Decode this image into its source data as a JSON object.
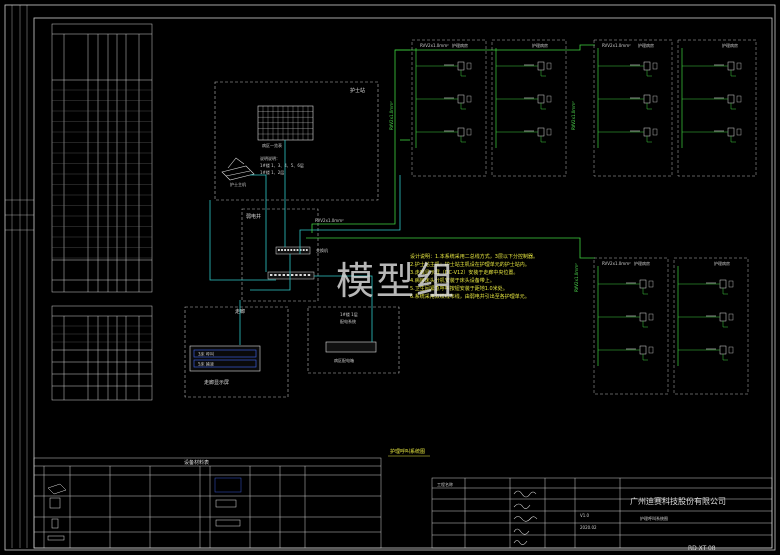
{
  "colors": {
    "background": "#000000",
    "frame": "#cfcfcf",
    "wire_green": "#3fd23f",
    "wire_cyan": "#2fc7c7",
    "label_yellow": "#e8e840",
    "screen_blue": "#3a5bd8"
  },
  "watermark": "模型组",
  "wards": {
    "label": "护理病房",
    "cable_spec": "RVV2x1.0mm²"
  },
  "nurse_station": {
    "label": "护士站",
    "console_label": "护士主机",
    "box_label": "病区一览表"
  },
  "equipment_room": {
    "label": "弱电井",
    "switch_label": "交换机"
  },
  "corridor": {
    "label": "走廊",
    "display_label": "走廊显示屏",
    "display_text_1": "3床 呼叫",
    "display_text_2": "5床 输液"
  },
  "power_box": {
    "label": "病区配电箱"
  },
  "system_title": "护理呼叫系统图",
  "equipment_list_title": "设备材料表",
  "title_block": {
    "company": "广州迪赛科技股份有限公司",
    "drawing_name": "护理呼叫系统图",
    "project_label": "工程名称",
    "version": "V1.0",
    "date": "2020.02",
    "drawing_code": "RD-XT-08"
  }
}
